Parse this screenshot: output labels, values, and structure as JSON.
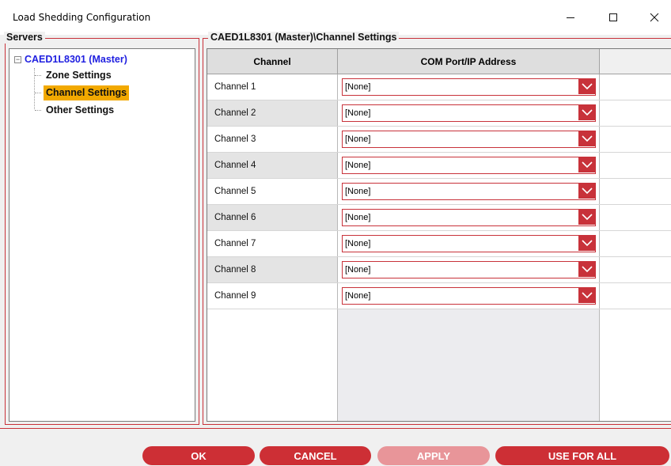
{
  "window": {
    "title": "Load Shedding Configuration",
    "minimize_glyph": "—",
    "maximize_glyph": "☐",
    "close_glyph": "✕"
  },
  "servers": {
    "group_label": "Servers",
    "root": {
      "expander": "−",
      "label": "CAED1L8301 (Master)"
    },
    "items": [
      {
        "label": "Zone Settings",
        "selected": false
      },
      {
        "label": "Channel Settings",
        "selected": true
      },
      {
        "label": "Other Settings",
        "selected": false
      }
    ]
  },
  "channel_settings": {
    "group_label": "CAED1L8301 (Master)\\Channel Settings",
    "columns": [
      "Channel",
      "COM Port/IP Address"
    ],
    "rows": [
      {
        "channel": "Channel 1",
        "com": "[None]"
      },
      {
        "channel": "Channel 2",
        "com": "[None]"
      },
      {
        "channel": "Channel 3",
        "com": "[None]"
      },
      {
        "channel": "Channel 4",
        "com": "[None]"
      },
      {
        "channel": "Channel 5",
        "com": "[None]"
      },
      {
        "channel": "Channel 6",
        "com": "[None]"
      },
      {
        "channel": "Channel 7",
        "com": "[None]"
      },
      {
        "channel": "Channel 8",
        "com": "[None]"
      },
      {
        "channel": "Channel 9",
        "com": "[None]"
      }
    ]
  },
  "buttons": {
    "ok": "OK",
    "cancel": "CANCEL",
    "apply": "APPLY",
    "use_for_all": "USE FOR ALL"
  },
  "colors": {
    "accent": "#cd2f35",
    "accent_disabled": "#e89599",
    "selection": "#f2a900",
    "root_text": "#1f1fe0"
  },
  "icons": {
    "dropdown": "chevron-down-icon",
    "expander": "tree-collapse-icon"
  }
}
